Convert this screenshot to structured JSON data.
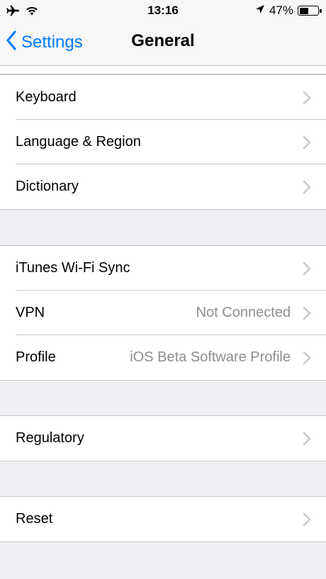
{
  "status": {
    "time": "13:16",
    "battery": "47%"
  },
  "nav": {
    "back_label": "Settings",
    "title": "General"
  },
  "groups": [
    {
      "rows": [
        {
          "label": "Keyboard",
          "value": ""
        },
        {
          "label": "Language & Region",
          "value": ""
        },
        {
          "label": "Dictionary",
          "value": ""
        }
      ]
    },
    {
      "rows": [
        {
          "label": "iTunes Wi-Fi Sync",
          "value": ""
        },
        {
          "label": "VPN",
          "value": "Not Connected"
        },
        {
          "label": "Profile",
          "value": "iOS Beta Software Profile"
        }
      ]
    },
    {
      "rows": [
        {
          "label": "Regulatory",
          "value": ""
        }
      ]
    },
    {
      "rows": [
        {
          "label": "Reset",
          "value": ""
        }
      ]
    }
  ],
  "colors": {
    "accent": "#007aff",
    "background": "#efeff4",
    "separator": "#c8c7cc",
    "secondary_text": "#8e8e93"
  }
}
